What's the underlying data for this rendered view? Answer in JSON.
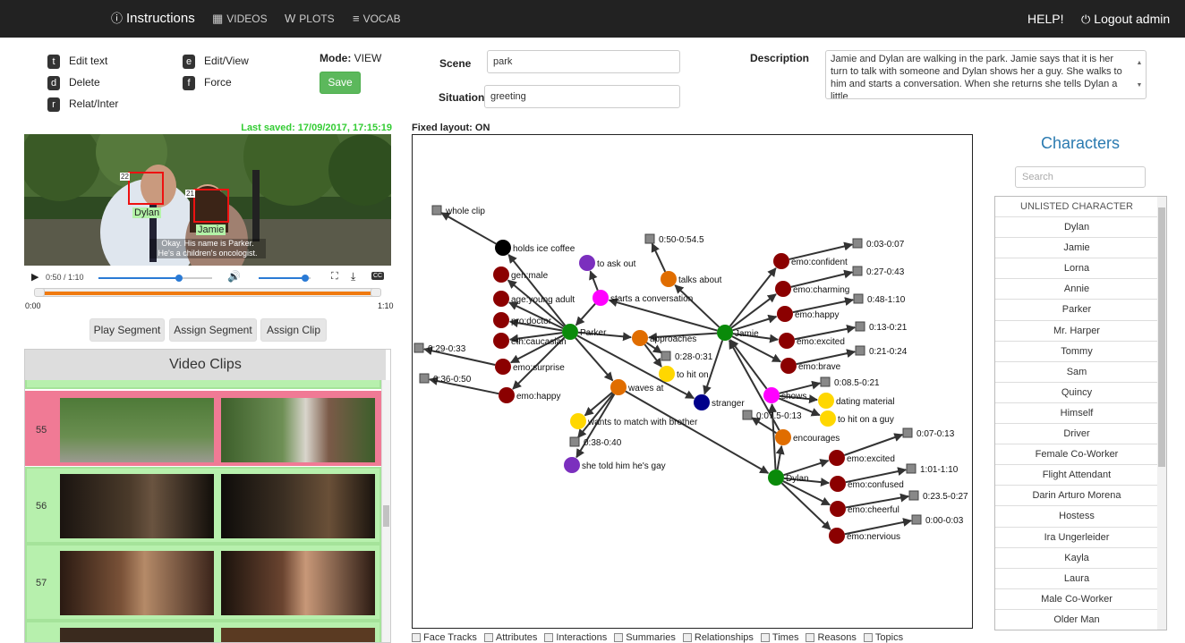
{
  "nav": {
    "instructions": "Instructions",
    "videos": "VIDEOS",
    "plots": "PLOTS",
    "vocab": "VOCAB",
    "help": "HELP!",
    "logout": "Logout admin"
  },
  "shortcuts": [
    {
      "key": "t",
      "label": "Edit text"
    },
    {
      "key": "d",
      "label": "Delete"
    },
    {
      "key": "r",
      "label": "Relat/Inter"
    },
    {
      "key": "e",
      "label": "Edit/View"
    },
    {
      "key": "f",
      "label": "Force"
    }
  ],
  "mode": {
    "label": "Mode:",
    "value": "VIEW"
  },
  "save_label": "Save",
  "scene": {
    "label": "Scene",
    "value": "park"
  },
  "situation": {
    "label": "Situation",
    "value": "greeting"
  },
  "description": {
    "label": "Description",
    "value": "Jamie and Dylan are walking in the park. Jamie says that it is her turn to talk with someone and Dylan shows her a guy. She walks to him and starts a conversation. When she returns she tells Dylan a little"
  },
  "last_saved": "Last saved: 17/09/2017, 17:15:19",
  "fixed_layout": "Fixed layout: ON",
  "video": {
    "face1_id": "22",
    "face1_name": "Dylan",
    "face2_id": "21",
    "face2_name": "Jamie",
    "subtitle1": "Okay. His name is Parker.",
    "subtitle2": "He's a children's oncologist.",
    "time": "0:50 / 1:10",
    "seg_start": "0:00",
    "seg_end": "1:10",
    "progress": 0.71,
    "volume": 0.9
  },
  "buttons": {
    "play_segment": "Play Segment",
    "assign_segment": "Assign Segment",
    "assign_clip": "Assign Clip"
  },
  "clips": {
    "title": "Video Clips",
    "rows": [
      {
        "num": "55",
        "selected": true
      },
      {
        "num": "56",
        "selected": false
      },
      {
        "num": "57",
        "selected": false
      }
    ]
  },
  "characters": {
    "title": "Characters",
    "search_placeholder": "Search",
    "list": [
      "UNLISTED CHARACTER",
      "Dylan",
      "Jamie",
      "Lorna",
      "Annie",
      "Parker",
      "Mr. Harper",
      "Tommy",
      "Sam",
      "Quincy",
      "Himself",
      "Driver",
      "Female Co-Worker",
      "Flight Attendant",
      "Darin Arturo Morena",
      "Hostess",
      "Ira Ungerleider",
      "Kayla",
      "Laura",
      "Male Co-Worker",
      "Older Man"
    ]
  },
  "checkboxes": [
    "Face Tracks",
    "Attributes",
    "Interactions",
    "Summaries",
    "Relationships",
    "Times",
    "Reasons",
    "Topics"
  ],
  "colors": {
    "character": "#0a8a0a",
    "attribute": "#8b0000",
    "interaction": "#e06d00",
    "summary": "#ff00ff",
    "reason": "#ffd700",
    "topic": "#7b2fbe",
    "relationship": "#00008b",
    "time": "#888888",
    "object": "#000000"
  },
  "graph": {
    "nodes": [
      {
        "label": "whole clip",
        "type": "time"
      },
      {
        "label": "holds ice coffee",
        "type": "object"
      },
      {
        "label": "gen:male",
        "type": "attribute"
      },
      {
        "label": "age:young adult",
        "type": "attribute"
      },
      {
        "label": "pro:doctor",
        "type": "attribute"
      },
      {
        "label": "eth:caucasian",
        "type": "attribute"
      },
      {
        "label": "emo:surprise",
        "type": "attribute"
      },
      {
        "label": "emo:happy",
        "type": "attribute"
      },
      {
        "label": "0:29-0:33",
        "type": "time"
      },
      {
        "label": "0:36-0:50",
        "type": "time"
      },
      {
        "label": "Parker",
        "type": "character"
      },
      {
        "label": "to ask out",
        "type": "topic"
      },
      {
        "label": "starts a conversation",
        "type": "summary"
      },
      {
        "label": "0:50-0:54.5",
        "type": "time"
      },
      {
        "label": "talks about",
        "type": "interaction"
      },
      {
        "label": "approaches",
        "type": "interaction"
      },
      {
        "label": "0:28-0:31",
        "type": "time"
      },
      {
        "label": "to hit on",
        "type": "reason"
      },
      {
        "label": "waves at",
        "type": "interaction"
      },
      {
        "label": "wants to match with brother",
        "type": "reason"
      },
      {
        "label": "0:38-0:40",
        "type": "time"
      },
      {
        "label": "she told him he's gay",
        "type": "topic"
      },
      {
        "label": "stranger",
        "type": "relationship"
      },
      {
        "label": "Jamie",
        "type": "character"
      },
      {
        "label": "emo:confident",
        "type": "attribute"
      },
      {
        "label": "0:03-0:07",
        "type": "time"
      },
      {
        "label": "emo:charming",
        "type": "attribute"
      },
      {
        "label": "0:27-0:43",
        "type": "time"
      },
      {
        "label": "emo:happy",
        "type": "attribute"
      },
      {
        "label": "0:48-1:10",
        "type": "time"
      },
      {
        "label": "emo:excited",
        "type": "attribute"
      },
      {
        "label": "0:13-0:21",
        "type": "time"
      },
      {
        "label": "emo:brave",
        "type": "attribute"
      },
      {
        "label": "0:21-0:24",
        "type": "time"
      },
      {
        "label": "shows",
        "type": "summary"
      },
      {
        "label": "0:08.5-0:21",
        "type": "time"
      },
      {
        "label": "dating material",
        "type": "reason"
      },
      {
        "label": "to hit on a guy",
        "type": "reason"
      },
      {
        "label": "0:07.5-0:13",
        "type": "time"
      },
      {
        "label": "encourages",
        "type": "interaction"
      },
      {
        "label": "Dylan",
        "type": "character"
      },
      {
        "label": "emo:excited",
        "type": "attribute"
      },
      {
        "label": "0:07-0:13",
        "type": "time"
      },
      {
        "label": "emo:confused",
        "type": "attribute"
      },
      {
        "label": "1:01-1:10",
        "type": "time"
      },
      {
        "label": "emo:cheerful",
        "type": "attribute"
      },
      {
        "label": "0:23.5-0:27",
        "type": "time"
      },
      {
        "label": "emo:nervious",
        "type": "attribute"
      },
      {
        "label": "0:00-0:03",
        "type": "time"
      }
    ]
  }
}
